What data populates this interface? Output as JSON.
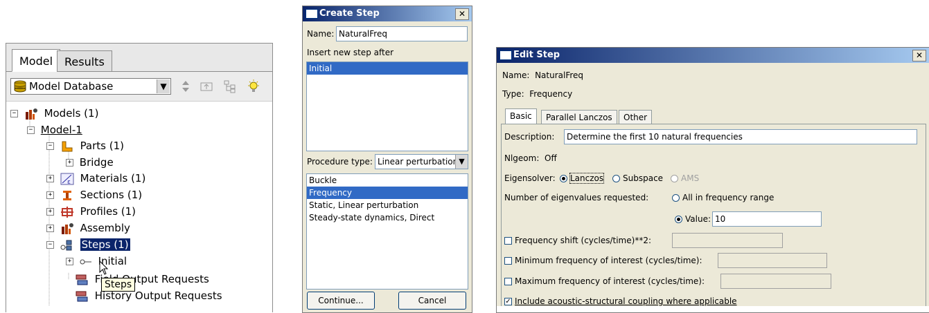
{
  "model_tree": {
    "tabs": [
      {
        "label": "Model",
        "active": true
      },
      {
        "label": "Results",
        "active": false
      }
    ],
    "database_label": "Model Database",
    "nodes": {
      "models": "Models (1)",
      "model1": "Model-1",
      "parts": "Parts (1)",
      "bridge": "Bridge",
      "materials": "Materials (1)",
      "sections": "Sections (1)",
      "profiles": "Profiles (1)",
      "assembly": "Assembly",
      "steps": "Steps (1)",
      "initial": "Initial",
      "field_requests": "Field Output Requests",
      "history_requests": "History Output Requests"
    },
    "tooltip": "Steps"
  },
  "create_step": {
    "title": "Create Step",
    "name_label": "Name:",
    "name_value": "NaturalFreq",
    "insert_after_label": "Insert new step after",
    "insert_after_items": [
      "Initial"
    ],
    "insert_after_selected": "Initial",
    "procedure_label": "Procedure type:",
    "procedure_value": "Linear perturbation",
    "procedures": [
      "Buckle",
      "Frequency",
      "Static, Linear perturbation",
      "Steady-state dynamics, Direct"
    ],
    "procedure_selected": "Frequency",
    "continue_label": "Continue...",
    "cancel_label": "Cancel",
    "close_glyph": "✕"
  },
  "edit_step": {
    "title": "Edit Step",
    "name_line": "Name:  NaturalFreq",
    "type_line": "Type:  Frequency",
    "tabs": [
      {
        "label": "Basic",
        "active": true
      },
      {
        "label": "Parallel Lanczos",
        "active": false
      },
      {
        "label": "Other",
        "active": false
      }
    ],
    "description_label": "Description:",
    "description_value": "Determine the first 10 natural frequencies",
    "nlgeom_line": "Nlgeom:  Off",
    "eigensolver_label": "Eigensolver:",
    "eigensolver_options": [
      {
        "label": "Lanczos",
        "selected": true,
        "enabled": true
      },
      {
        "label": "Subspace",
        "selected": false,
        "enabled": true
      },
      {
        "label": "AMS",
        "selected": false,
        "enabled": false
      }
    ],
    "num_eig_label": "Number of eigenvalues requested:",
    "all_in_range_label": "All in frequency range",
    "value_label": "Value:",
    "value": "10",
    "freq_shift_label": "Frequency shift (cycles/time)**2:",
    "min_freq_label": "Minimum frequency of interest (cycles/time):",
    "max_freq_label": "Maximum frequency of interest (cycles/time):",
    "acoustic_label": "Include acoustic-structural coupling where applicable",
    "acoustic_checked": true,
    "close_glyph": "✕"
  },
  "colors": {
    "selection": "#316ac5",
    "titlebar_start": "#0a246a",
    "titlebar_end": "#a6caf0",
    "dialog_bg": "#ece9d8"
  },
  "icons": [
    "database-icon",
    "models-icon",
    "parts-icon",
    "materials-icon",
    "sections-icon",
    "profiles-icon",
    "assembly-icon",
    "steps-icon",
    "step-initial-icon",
    "field-output-icon",
    "history-output-icon",
    "lightbulb-icon"
  ]
}
